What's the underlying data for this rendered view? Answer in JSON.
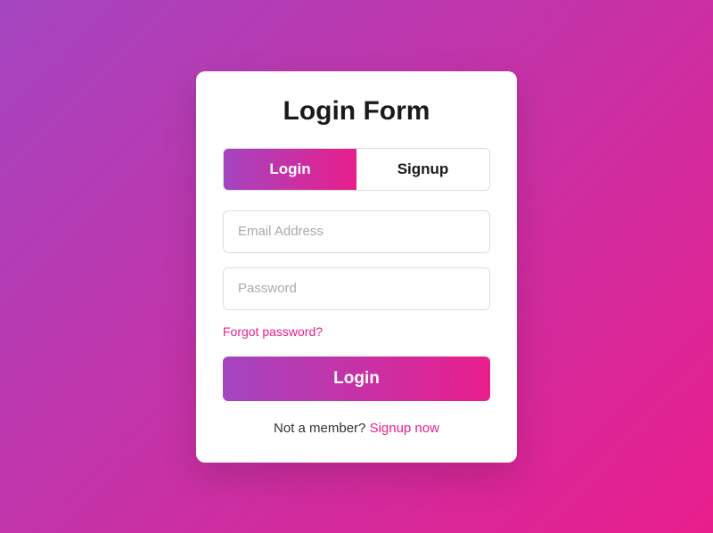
{
  "title": "Login Form",
  "tabs": {
    "login": "Login",
    "signup": "Signup"
  },
  "fields": {
    "email_placeholder": "Email Address",
    "password_placeholder": "Password"
  },
  "links": {
    "forgot": "Forgot password?",
    "signup_prompt": "Not a member? ",
    "signup_link": "Signup now"
  },
  "buttons": {
    "submit": "Login"
  }
}
